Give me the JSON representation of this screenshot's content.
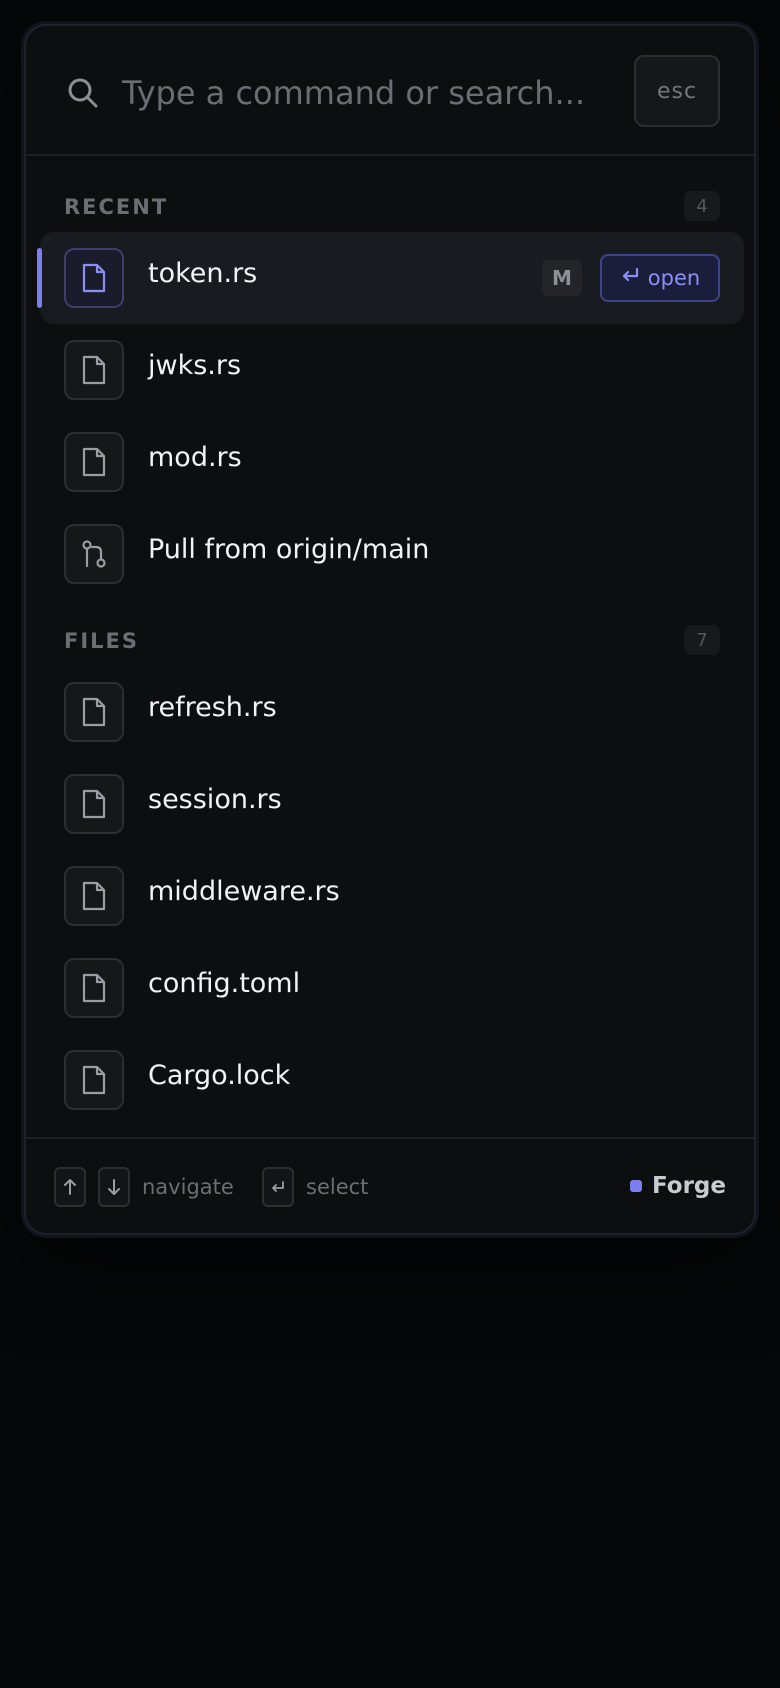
{
  "search": {
    "placeholder": "Type a command or search...",
    "value": "",
    "esc_label": "esc"
  },
  "sections": [
    {
      "title": "RECENT",
      "count": "4",
      "items": [
        {
          "label": "token.rs",
          "icon": "file-icon",
          "selected": true,
          "modifier": "M",
          "action": "open"
        },
        {
          "label": "jwks.rs",
          "icon": "file-icon"
        },
        {
          "label": "mod.rs",
          "icon": "file-icon"
        },
        {
          "label": "Pull from origin/main",
          "icon": "git-pull-icon"
        }
      ]
    },
    {
      "title": "FILES",
      "count": "7",
      "items": [
        {
          "label": "refresh.rs",
          "icon": "file-icon"
        },
        {
          "label": "session.rs",
          "icon": "file-icon"
        },
        {
          "label": "middleware.rs",
          "icon": "file-icon"
        },
        {
          "label": "config.toml",
          "icon": "file-icon"
        },
        {
          "label": "Cargo.lock",
          "icon": "file-icon"
        }
      ]
    }
  ],
  "footer": {
    "navigate_label": "navigate",
    "select_label": "select",
    "brand": "Forge"
  },
  "colors": {
    "accent": "#7b7ff0",
    "background": "#0c0e10",
    "selected_row": "#181b1f",
    "text": "#f2f3f5",
    "muted": "#6b6e75"
  }
}
